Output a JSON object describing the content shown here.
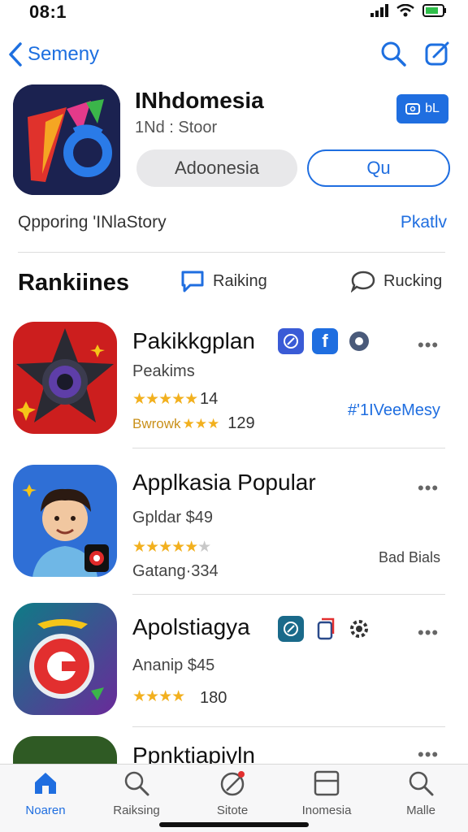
{
  "status": {
    "time": "08:1"
  },
  "nav": {
    "back_label": "Semeny"
  },
  "app": {
    "title": "INhdomesia",
    "subtitle": "1Nd : Stoor",
    "badge_label": "bL",
    "pill_primary": "Adoonesia",
    "pill_secondary": "Qu"
  },
  "info": {
    "left": "Qpporing 'INlaStory",
    "right": "Pkatlv"
  },
  "rankings": {
    "title": "Rankiines",
    "tab1": "Raiking",
    "tab2": "Rucking"
  },
  "apps": [
    {
      "name": "Pakikkgplan",
      "sub": "Peakims",
      "stars": "★★★★★",
      "rating": "14",
      "sub2": "Bwrowk",
      "sub2_stars": "★★★",
      "rating2": "129",
      "tag": "#'1IVeeMesy",
      "accent": "#d32121"
    },
    {
      "name": "Applkasia Popular",
      "sub": "Gpldar $49",
      "stars": "★★★★★",
      "extra_star": "★",
      "sub2": "Gatang·334",
      "tag": "Bad Bials",
      "accent": "#2f6fd6"
    },
    {
      "name": "Apolstiagya",
      "sub": "Ananip $45",
      "stars": "★★★★",
      "rating": "180",
      "accent": "#e22f2f"
    },
    {
      "name": "Ppnktiapiyln",
      "accent": "#3a6a2a"
    }
  ],
  "tabs": [
    {
      "label": "Noaren",
      "icon": "home-icon"
    },
    {
      "label": "Raiksing",
      "icon": "search-icon"
    },
    {
      "label": "Sitote",
      "icon": "compass-icon"
    },
    {
      "label": "Inomesia",
      "icon": "window-icon"
    },
    {
      "label": "Malle",
      "icon": "magnifier-icon"
    }
  ],
  "colors": {
    "accent": "#1f6ee0",
    "star": "#f2b01e"
  }
}
